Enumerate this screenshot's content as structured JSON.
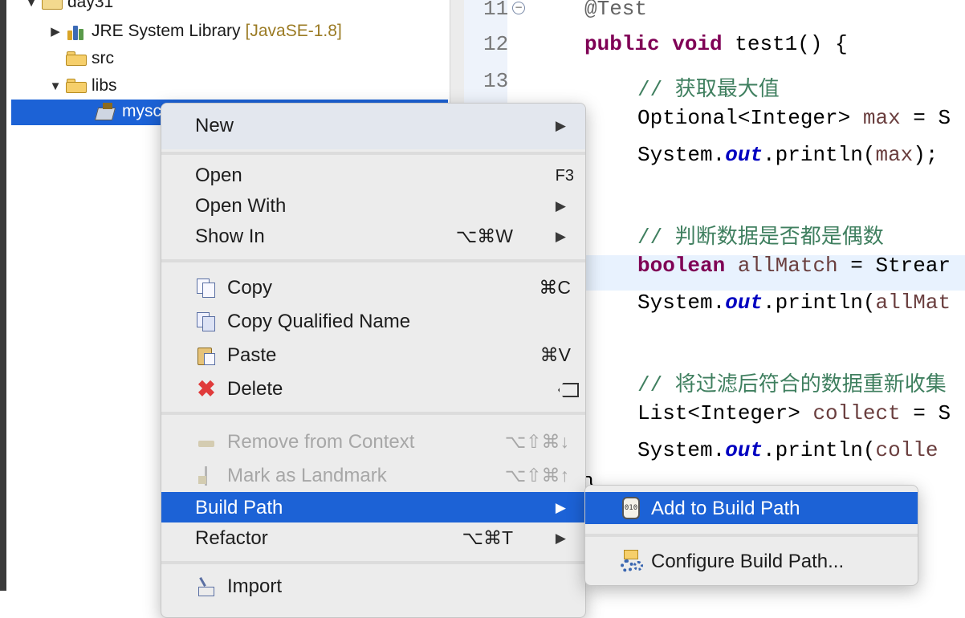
{
  "tree": {
    "project": "day31",
    "items": [
      {
        "label": "JRE System Library",
        "decoration": "[JavaSE-1.8]"
      },
      {
        "label": "src"
      },
      {
        "label": "libs"
      },
      {
        "label": "mysc"
      }
    ]
  },
  "editor": {
    "line_numbers": [
      "11",
      "12",
      "13"
    ],
    "lines": {
      "l1": "@Test",
      "l2_kw": "public void",
      "l2_rest": " test1() {",
      "l3": "// 获取最大值",
      "l4_a": "Optional<Integer> ",
      "l4_var": "max",
      "l4_b": " = S",
      "l5_a": "System.",
      "l5_fld": "out",
      "l5_b": ".println(",
      "l5_var": "max",
      "l5_c": ");",
      "l6": "// 判断数据是否都是偶数",
      "l7_kw": "boolean",
      "l7_sp": " ",
      "l7_var": "allMatch",
      "l7_b": " = Strear",
      "l8_a": "System.",
      "l8_fld": "out",
      "l8_b": ".println(",
      "l8_var": "allMat",
      "l9": "// 将过滤后符合的数据重新收集",
      "l10_a": "List<Integer> ",
      "l10_var": "collect",
      "l10_b": " = S",
      "l11_a": "System.",
      "l11_fld": "out",
      "l11_b": ".println(",
      "l11_var": "colle",
      "l12": "}"
    }
  },
  "context_menu": {
    "new": "New",
    "open": "Open",
    "open_sc": "F3",
    "open_with": "Open With",
    "show_in": "Show In",
    "show_in_sc": "⌥⌘W",
    "copy": "Copy",
    "copy_sc": "⌘C",
    "copy_qualified": "Copy Qualified Name",
    "paste": "Paste",
    "paste_sc": "⌘V",
    "delete": "Delete",
    "delete_sc": "⌦",
    "remove_context": "Remove from Context",
    "remove_context_sc": "⌥⇧⌘↓",
    "mark_landmark": "Mark as Landmark",
    "mark_landmark_sc": "⌥⇧⌘↑",
    "build_path": "Build Path",
    "refactor": "Refactor",
    "refactor_sc": "⌥⌘T",
    "import": "Import",
    "arrow": "▶"
  },
  "submenu": {
    "add_to_build_path": "Add to Build Path",
    "configure_build_path": "Configure Build Path...",
    "jar_text": "010"
  },
  "colors": {
    "selection": "#1c62d6",
    "keyword": "#7f0055",
    "comment": "#3f7f5f",
    "field": "#0000c0"
  }
}
